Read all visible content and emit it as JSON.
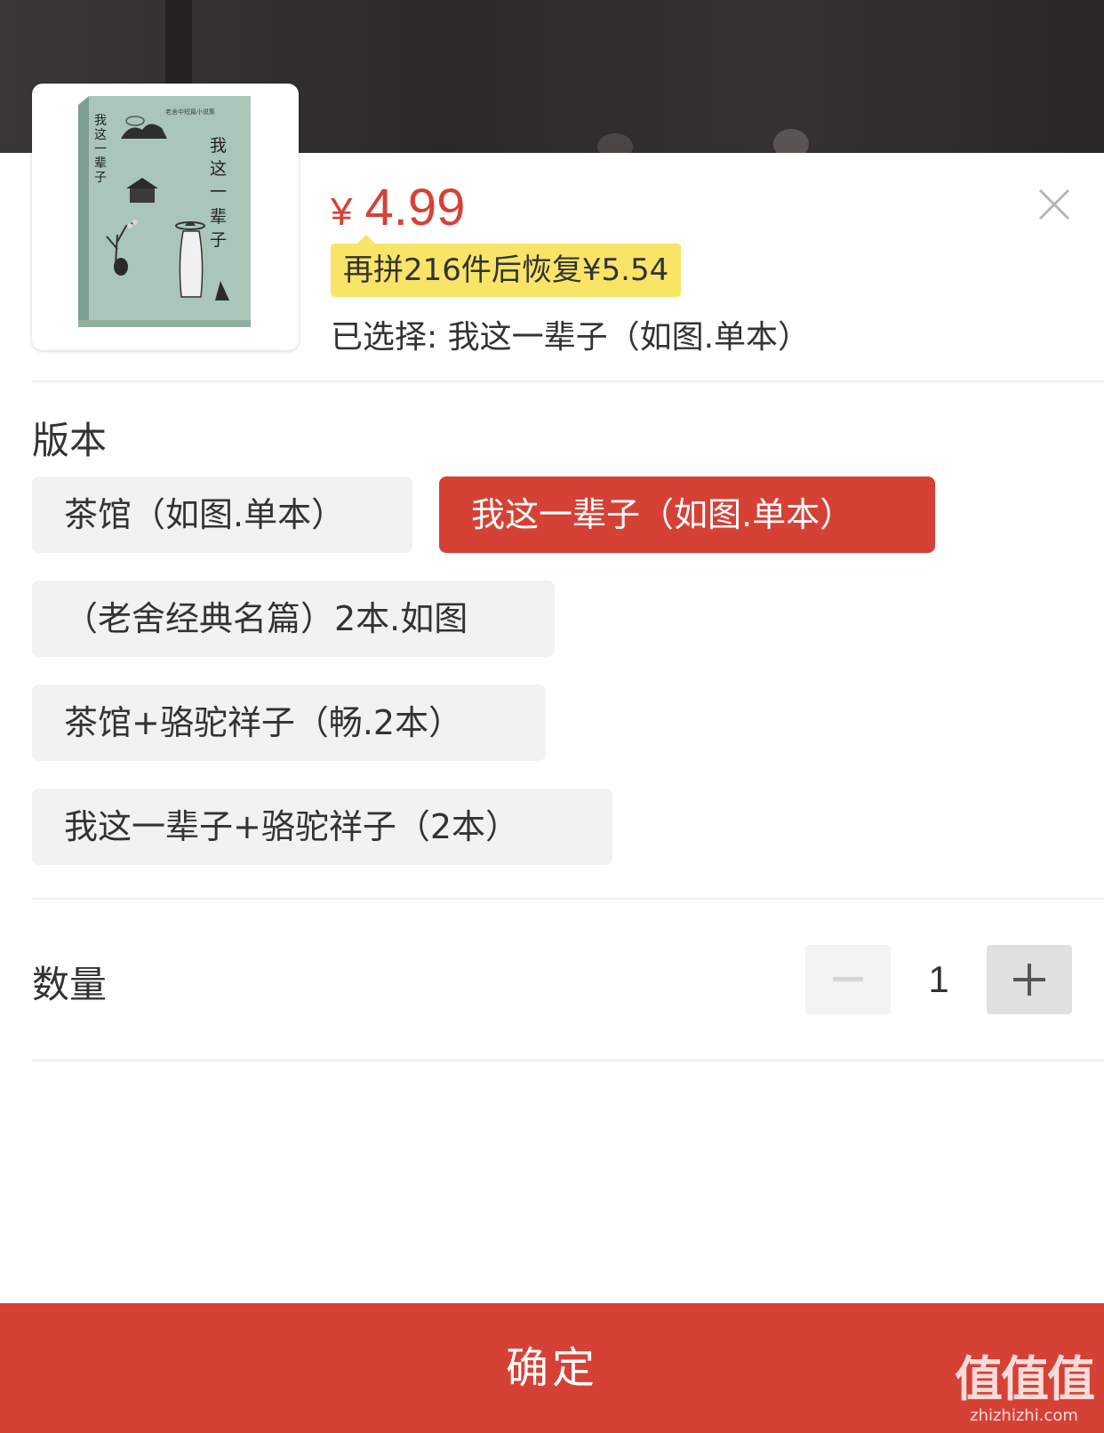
{
  "product": {
    "price_symbol": "¥",
    "price": "4.99",
    "promo_tip": "再拼216件后恢复¥5.54",
    "selected_text": "已选择: 我这一辈子（如图.单本）",
    "cover": {
      "title_vertical": "我这一辈子",
      "series_vertical": "老舍中短篇小说集",
      "cover_color": "#a9c6b8"
    }
  },
  "variant_section": {
    "label": "版本",
    "options": [
      {
        "label": "茶馆（如图.单本）",
        "selected": false
      },
      {
        "label": "我这一辈子（如图.单本）",
        "selected": true
      },
      {
        "label": "（老舍经典名篇）2本.如图",
        "selected": false
      },
      {
        "label": "茶馆+骆驼祥子（畅.2本）",
        "selected": false
      },
      {
        "label": "我这一辈子+骆驼祥子（2本）",
        "selected": false
      }
    ]
  },
  "quantity_section": {
    "label": "数量",
    "value": "1",
    "minus_icon": "minus-icon",
    "plus_icon": "plus-icon"
  },
  "confirm_button": {
    "label": "确定"
  },
  "watermark": {
    "big": "值值值",
    "small": "zhizhizhi.com"
  },
  "colors": {
    "accent": "#d64136",
    "tip_bg": "#f8e466",
    "option_bg": "#f2f2f2"
  }
}
